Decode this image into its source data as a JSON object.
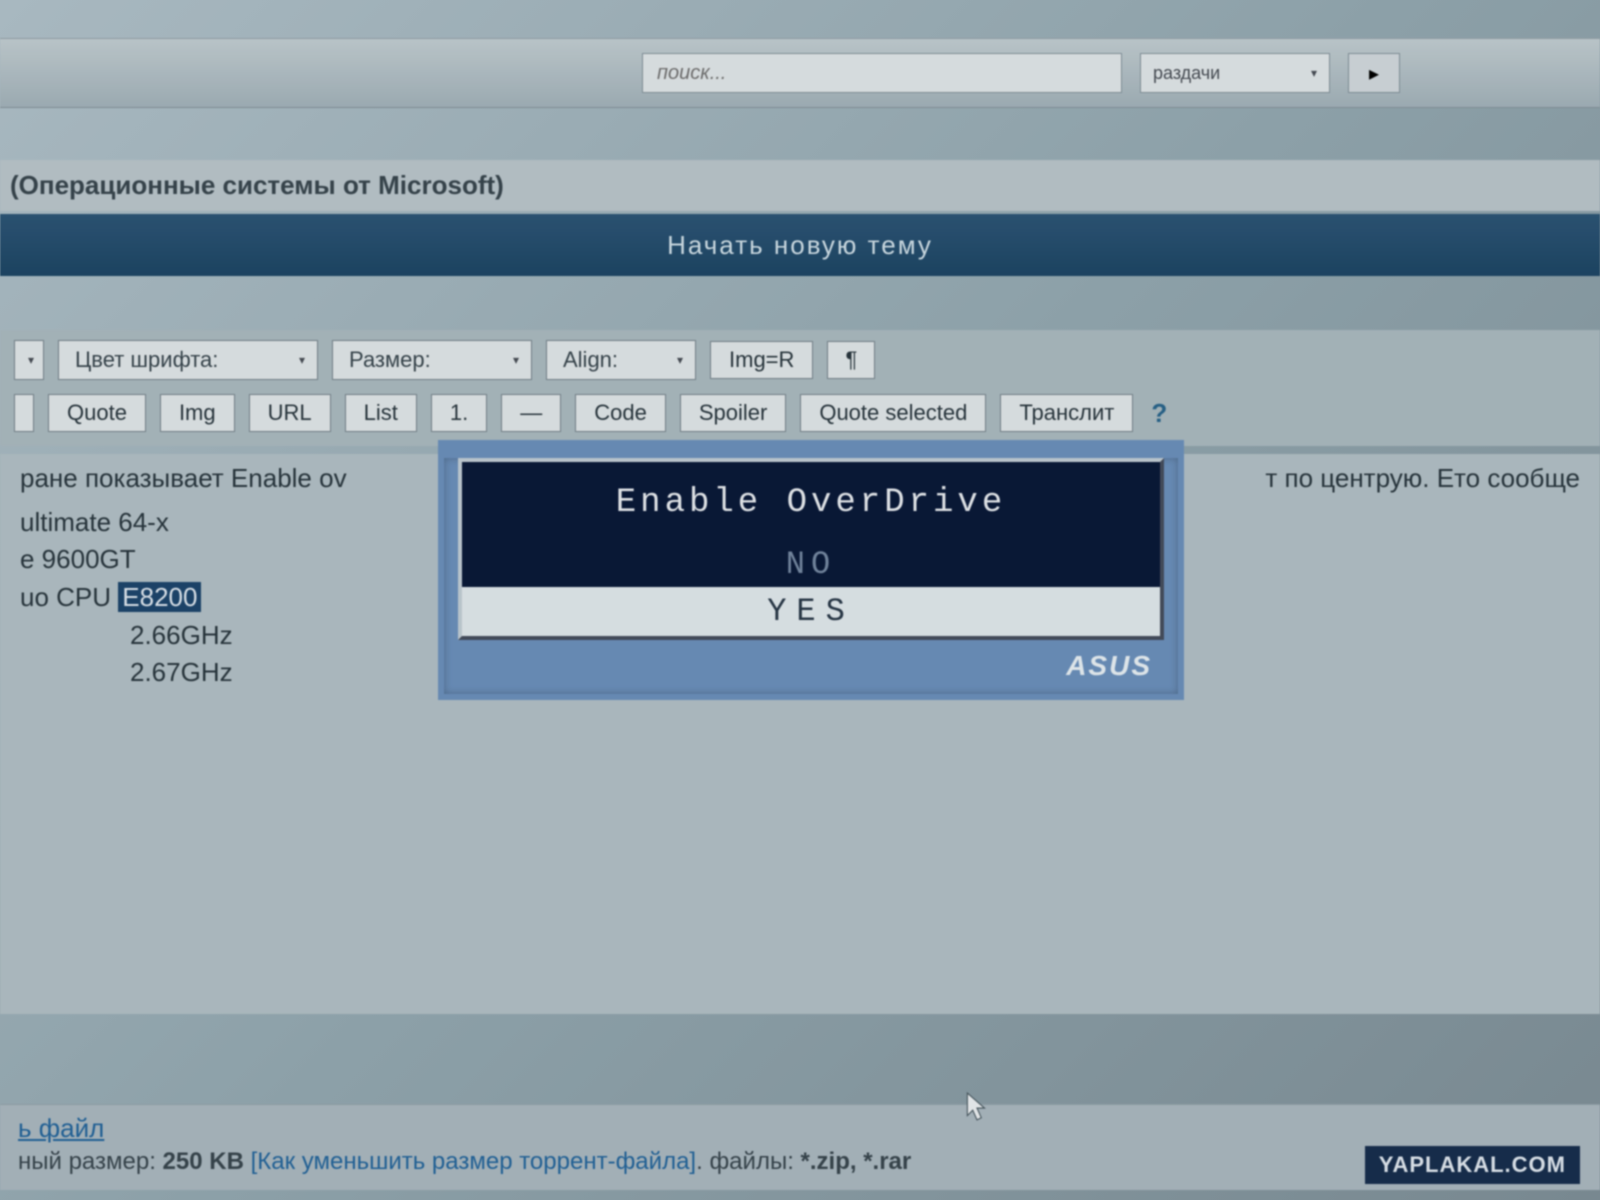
{
  "topbar": {
    "search_placeholder": "поиск...",
    "category_label": "раздачи",
    "go_icon": "▸"
  },
  "crumb": {
    "text": "(Операционные системы от Microsoft)"
  },
  "banner": {
    "text": "Начать новую тему"
  },
  "toolbar": {
    "row1": {
      "font_color": "Цвет шрифта:",
      "size": "Размер:",
      "align": "Align:",
      "img_r": "Img=R",
      "para": "¶"
    },
    "row2": {
      "quote": "Quote",
      "img": "Img",
      "url": "URL",
      "list": "List",
      "listnum": "1.",
      "dash": "—",
      "code": "Code",
      "spoiler": "Spoiler",
      "quote_selected": "Quote selected",
      "translit": "Транслит",
      "help": "?"
    }
  },
  "post": {
    "line1_left": "ране показывает Enable ov",
    "line1_right": "т по центрую. Ето сообще",
    "specs": {
      "l1": "ultimate 64-x",
      "l2": "e 9600GT",
      "l3_prefix": "uo CPU",
      "l3_sel": "E8200",
      "l4": "2.66GHz",
      "l5": "2.67GHz"
    }
  },
  "bios": {
    "title": "Enable OverDrive",
    "no": "NO",
    "yes": "YES",
    "brand": "ASUS"
  },
  "attach": {
    "link": "ь файл",
    "size_label": "ный размер:",
    "size_value": "250 KB",
    "hint": "[Как уменьшить размер торрент-файла]",
    "files_label": "файлы:",
    "files_value": "*.zip, *.rar"
  },
  "watermark": "YAPLAKAL.COM"
}
